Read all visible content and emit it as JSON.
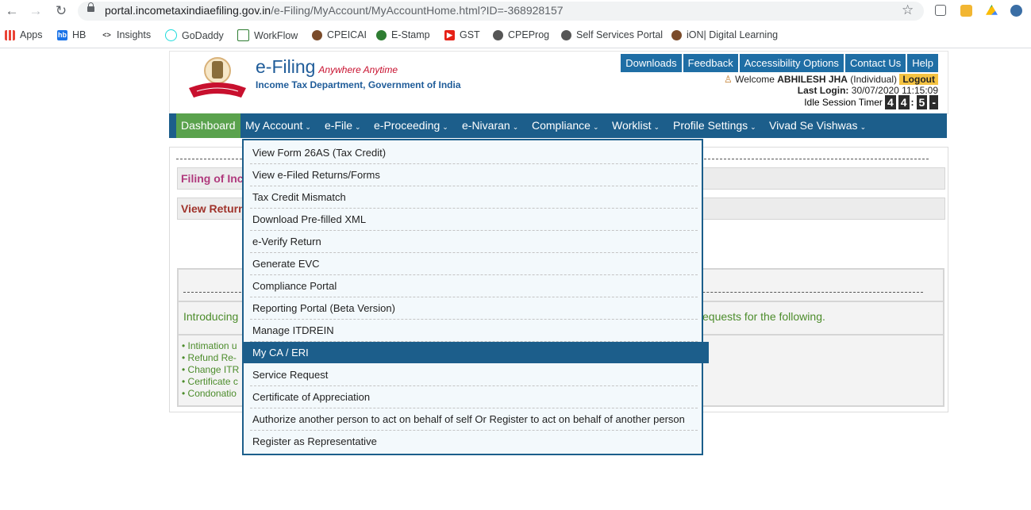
{
  "browser": {
    "url_host": "portal.incometaxindiaefiling.gov.in",
    "url_path": "/e-Filing/MyAccount/MyAccountHome.html?ID=-368928157",
    "bookmarks": [
      {
        "label": "Apps",
        "icon": "apps-grid-icon"
      },
      {
        "label": "HB",
        "icon": "hb-icon"
      },
      {
        "label": "Insights",
        "icon": "code-icon"
      },
      {
        "label": "GoDaddy",
        "icon": "godaddy-icon"
      },
      {
        "label": "WorkFlow",
        "icon": "workflow-icon"
      },
      {
        "label": "CPEICAI",
        "icon": "icai-icon"
      },
      {
        "label": "E-Stamp",
        "icon": "estamp-icon"
      },
      {
        "label": "GST",
        "icon": "youtube-icon"
      },
      {
        "label": "CPEProg",
        "icon": "globe-icon"
      },
      {
        "label": "Self Services Portal",
        "icon": "globe-icon"
      },
      {
        "label": "iON| Digital Learning",
        "icon": "icai-icon"
      }
    ]
  },
  "header": {
    "title": "e-Filing",
    "tagline": "Anywhere Anytime",
    "subtitle": "Income Tax Department, Government of India",
    "top_links": [
      "Downloads",
      "Feedback",
      "Accessibility Options",
      "Contact Us",
      "Help"
    ],
    "welcome_prefix": "Welcome",
    "user_name": "ABHILESH JHA",
    "user_type": "(Individual)",
    "logout": "Logout",
    "last_login_label": "Last Login:",
    "last_login_value": "30/07/2020 11:15:09",
    "idle_timer_label": "Idle Session Timer",
    "timer_digits": [
      "4",
      "4",
      ":",
      "5",
      "-"
    ]
  },
  "menu": {
    "items": [
      "Dashboard",
      "My Account",
      "e-File",
      "e-Proceeding",
      "e-Nivaran",
      "Compliance",
      "Worklist",
      "Profile Settings",
      "Vivad Se Vishwas"
    ],
    "active": "Dashboard"
  },
  "content": {
    "row1": "Filing of Inco",
    "row2": "View Return",
    "intro_left": "Introducing",
    "intro_right": "equests for the following.",
    "bullets": [
      "Intimation u",
      "Refund Re-",
      "Change ITR",
      "Certificate c",
      "Condonatio"
    ]
  },
  "dropdown": {
    "items": [
      "View Form 26AS (Tax Credit)",
      "View e-Filed Returns/Forms",
      "Tax Credit Mismatch",
      "Download Pre-filled XML",
      "e-Verify Return",
      "Generate EVC",
      "Compliance Portal",
      "Reporting Portal (Beta Version)",
      "Manage ITDREIN",
      "My CA / ERI",
      "Service Request",
      "Certificate of Appreciation",
      "Authorize another person to act on behalf of self Or Register to act on behalf of another person",
      "Register as Representative"
    ],
    "highlighted_index": 9
  }
}
